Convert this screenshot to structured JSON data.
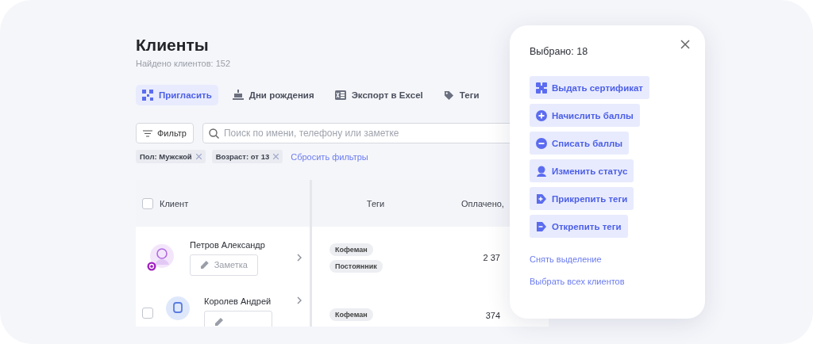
{
  "page": {
    "title": "Клиенты",
    "subtitle": "Найдено клиентов: 152"
  },
  "toolbar": [
    {
      "label": "Пригласить",
      "kind": "qr",
      "selected": true
    },
    {
      "label": "Дни рождения",
      "kind": "cake",
      "selected": false
    },
    {
      "label": "Экспорт в Excel",
      "kind": "excel",
      "selected": false
    },
    {
      "label": "Теги",
      "kind": "tag",
      "selected": false
    }
  ],
  "filter_button": "Фильтр",
  "search": {
    "placeholder": "Поиск по имени, телефону или заметке"
  },
  "active_filters": [
    "Пол: Мужской",
    "Возраст: от 13"
  ],
  "reset_filters": "Сбросить фильтры",
  "table": {
    "select_all_checked": false,
    "columns": [
      "Клиент",
      "Теги",
      "Оплачено,"
    ],
    "rows": [
      {
        "name": "Петров Александр",
        "kind": "badge",
        "note": "Заметка",
        "tags": [
          "Кофеман",
          "Постоянник"
        ],
        "paid": "2 37"
      },
      {
        "name": "Королев Андрей",
        "kind": "checkbox",
        "checked": false,
        "note": "",
        "tags": [
          "Кофеман"
        ],
        "paid": "374"
      }
    ]
  },
  "selection_panel": {
    "title": "Выбрано: 18",
    "actions": [
      {
        "label": "Выдать сертификат",
        "kind": "certificate"
      },
      {
        "label": "Начислить баллы",
        "kind": "plus"
      },
      {
        "label": "Списать баллы",
        "kind": "minus"
      },
      {
        "label": "Изменить статус",
        "kind": "status"
      },
      {
        "label": "Прикрепить теги",
        "kind": "tag-plus"
      },
      {
        "label": "Открепить теги",
        "kind": "tag-minus"
      }
    ],
    "links": [
      "Снять выделение",
      "Выбрать всех клиентов"
    ]
  }
}
